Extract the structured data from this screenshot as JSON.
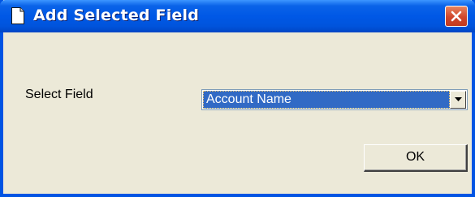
{
  "window": {
    "title": "Add Selected Field",
    "title_icon": "document-icon",
    "close_icon": "close-icon"
  },
  "form": {
    "field_label": "Select Field",
    "field_select": {
      "selected_value": "Account Name",
      "arrow_icon": "chevron-down-icon"
    }
  },
  "buttons": {
    "ok_label": "OK"
  },
  "colors": {
    "titlebar": "#0054E3",
    "dialog_bg": "#ECE9D8",
    "selection_bg": "#316AC5",
    "close_button": "#D0462B"
  }
}
